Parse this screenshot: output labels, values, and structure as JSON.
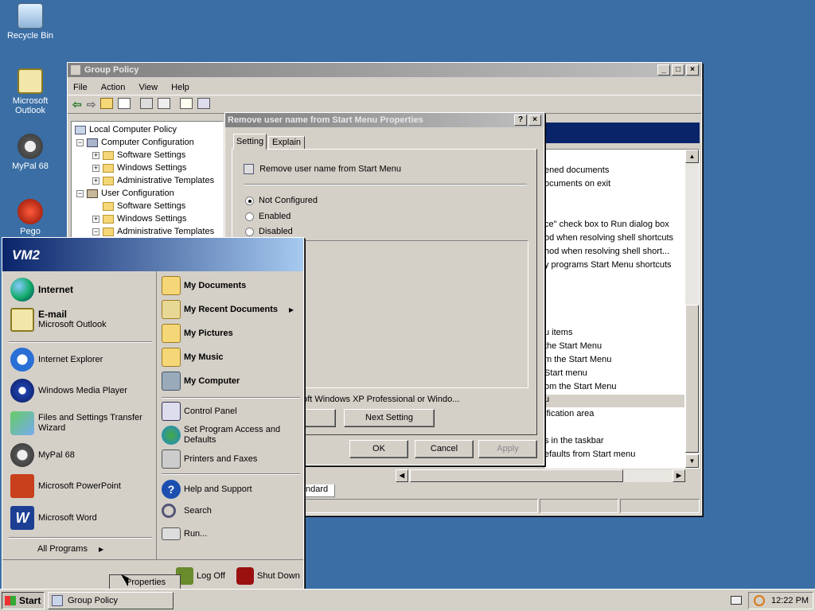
{
  "desktop": {
    "icons": [
      {
        "label": "Recycle Bin"
      },
      {
        "label": "Microsoft Outlook"
      },
      {
        "label": "MyPal 68"
      },
      {
        "label": "Pego"
      }
    ]
  },
  "gp_window": {
    "title": "Group Policy",
    "menu": [
      "File",
      "Action",
      "View",
      "Help"
    ],
    "tree": [
      "Local Computer Policy",
      "Computer Configuration",
      "Software Settings",
      "Windows Settings",
      "Administrative Templates",
      "User Configuration",
      "Software Settings",
      "Windows Settings",
      "Administrative Templates"
    ],
    "list": [
      "ened documents",
      "ocuments on exit",
      "ce\" check box to Run dialog box",
      "od when resolving shell shortcuts",
      "hod when resolving shell short...",
      "y programs Start Menu shortcuts",
      "u items",
      "the Start Menu",
      "m the Start Menu",
      "Start menu",
      "om the Start Menu",
      "u",
      "ification area",
      "s in the taskbar",
      "efaults from Start menu"
    ],
    "status_tab": "ndard"
  },
  "dialog": {
    "title": "Remove user name from Start Menu Properties",
    "tabs": [
      "Setting",
      "Explain"
    ],
    "policy_name": "Remove user name from Start Menu",
    "options": [
      "Not Configured",
      "Enabled",
      "Disabled"
    ],
    "supported": "At least Microsoft Windows XP Professional or Windo...",
    "prev_btn": "tting",
    "next_btn": "Next Setting",
    "ok": "OK",
    "cancel": "Cancel",
    "apply": "Apply"
  },
  "start_menu": {
    "user": "VM2",
    "pinned": [
      {
        "title": "Internet",
        "sub": ""
      },
      {
        "title": "E-mail",
        "sub": "Microsoft Outlook"
      }
    ],
    "recent": [
      "Internet Explorer",
      "Windows Media Player",
      "Files and Settings Transfer Wizard",
      "MyPal 68",
      "Microsoft PowerPoint",
      "Microsoft Word"
    ],
    "all_programs": "All Programs",
    "right": [
      "My Documents",
      "My Recent Documents",
      "My Pictures",
      "My Music",
      "My Computer",
      "Control Panel",
      "Set Program Access and Defaults",
      "Printers and Faxes",
      "Help and Support",
      "Search",
      "Run..."
    ],
    "logoff": "Log Off",
    "shutdown": "Shut Down",
    "tooltip": "Properties"
  },
  "taskbar": {
    "start": "Start",
    "task": "Group Policy",
    "clock": "12:22 PM"
  }
}
